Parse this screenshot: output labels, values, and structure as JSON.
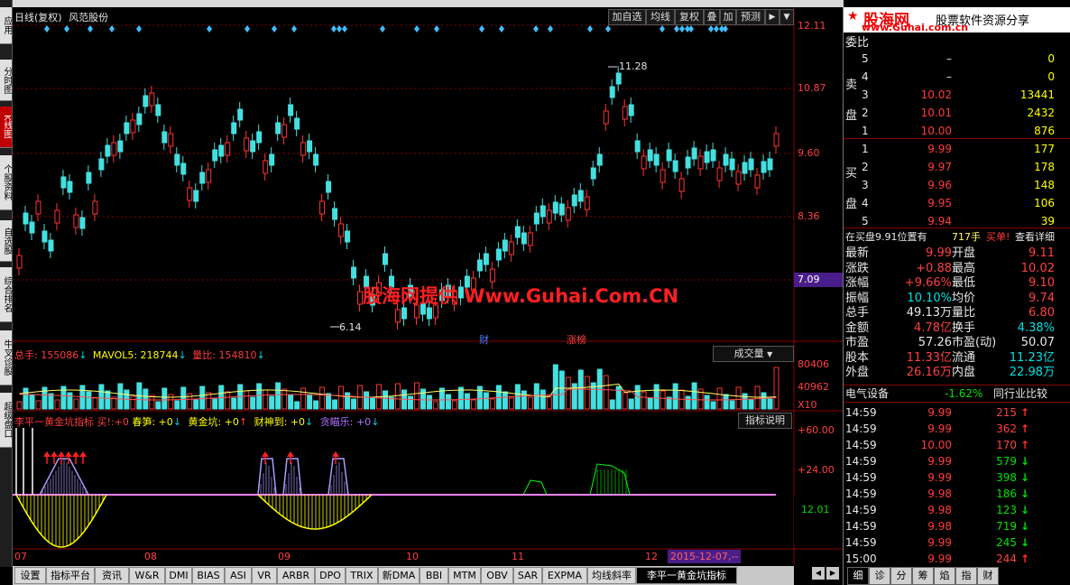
{
  "left_toolbar": [
    {
      "label": "应用",
      "active": false
    },
    {
      "label": "分时图",
      "active": false
    },
    {
      "label": "K线图",
      "active": true
    },
    {
      "label": "个股资料",
      "active": false
    },
    {
      "label": "自选股",
      "active": false
    },
    {
      "label": "综合排名",
      "active": false
    },
    {
      "label": "牛叉诊股",
      "active": false
    },
    {
      "label": "超级盘口",
      "active": false
    }
  ],
  "chart_header": {
    "title": "日线(复权)",
    "pattern": "风范股份"
  },
  "toolbar_buttons": [
    "加自选",
    "均线",
    "复权",
    "叠",
    "加",
    "预测"
  ],
  "watermark": "股海网提供 Www.Guhai.Com.CN",
  "price_axis": [
    "12.11",
    "10.87",
    "9.60",
    "8.36",
    "7.09"
  ],
  "high_label": "11.28",
  "low_label": "6.14",
  "event_labels": [
    "财",
    "涨榜"
  ],
  "volume_header": {
    "total_label": "总手: 155086",
    "mavol_label": "MAVOL5: 218744",
    "ratio_label": "量比: 154810",
    "dropdown": "成交量"
  },
  "volume_axis": [
    "80406",
    "40962",
    "X10"
  ],
  "indicator_header": {
    "name": "李平一黄金坑指标",
    "buy": "买!",
    "buy_val": ":+0",
    "chunsun": "春笋: +0",
    "huangjin": "黄金坑: +0",
    "caishen": "财神到: +0",
    "tanmi": "贪瞄乐: +0",
    "help_btn": "指标说明"
  },
  "indicator_axis": [
    "+60.00",
    "+24.00",
    "12.01"
  ],
  "date_axis": [
    "07",
    "08",
    "09",
    "10",
    "11",
    "12",
    "2015-12-07,--"
  ],
  "bottom_tabs": [
    "设置",
    "指标平台",
    "资讯",
    "W&R",
    "DMI",
    "BIAS",
    "ASI",
    "VR",
    "ARBR",
    "DPO",
    "TRIX",
    "新DMA",
    "BBI",
    "MTM",
    "OBV",
    "SAR",
    "EXPMA",
    "均线斜率",
    "李平一黄金坑指标"
  ],
  "brand": {
    "name": "股海网",
    "url": "www.Guhai.com.cn",
    "slogan": "股票软件资源分享"
  },
  "order_book": {
    "header": "委比",
    "sell_label": "卖盘",
    "buy_label": "买盘",
    "sell": [
      {
        "level": "5",
        "price": "–",
        "vol": "0"
      },
      {
        "level": "4",
        "price": "–",
        "vol": "0"
      },
      {
        "level": "3",
        "price": "10.02",
        "vol": "13441"
      },
      {
        "level": "2",
        "price": "10.01",
        "vol": "2432"
      },
      {
        "level": "1",
        "price": "10.00",
        "vol": "876"
      }
    ],
    "buy": [
      {
        "level": "1",
        "price": "9.99",
        "vol": "177"
      },
      {
        "level": "2",
        "price": "9.97",
        "vol": "178"
      },
      {
        "level": "3",
        "price": "9.96",
        "vol": "148"
      },
      {
        "level": "4",
        "price": "9.95",
        "vol": "106"
      },
      {
        "level": "5",
        "price": "9.94",
        "vol": "39"
      }
    ]
  },
  "order_status": {
    "text": "在买盘9.91位置有",
    "vol": "717手",
    "buy": "买单!",
    "detail": "查看详细"
  },
  "quote": [
    {
      "l1": "最新",
      "v1": "9.99",
      "l2": "开盘",
      "v2": "9.11"
    },
    {
      "l1": "涨跌",
      "v1": "+0.88",
      "l2": "最高",
      "v2": "10.02"
    },
    {
      "l1": "涨幅",
      "v1": "+9.66%",
      "l2": "最低",
      "v2": "9.10"
    },
    {
      "l1": "振幅",
      "v1": "10.10%",
      "l2": "均价",
      "v2": "9.74"
    },
    {
      "l1": "总手",
      "v1": "49.13万",
      "l2": "量比",
      "v2": "6.80"
    },
    {
      "l1": "金额",
      "v1": "4.78亿",
      "l2": "换手",
      "v2": "4.38%"
    },
    {
      "l1": "市盈",
      "v1": "57.26",
      "l2": "市盈(动)",
      "v2": "50.07"
    },
    {
      "l1": "股本",
      "v1": "11.33亿",
      "l2": "流通",
      "v2": "11.23亿"
    },
    {
      "l1": "外盘",
      "v1": "26.16万",
      "l2": "内盘",
      "v2": "22.98万"
    }
  ],
  "sector": {
    "name": "电气设备",
    "change": "-1.62%",
    "compare": "同行业比较"
  },
  "ticks": [
    {
      "time": "14:59",
      "price": "9.99",
      "vol": "215",
      "dir": "up"
    },
    {
      "time": "14:59",
      "price": "9.99",
      "vol": "362",
      "dir": "up"
    },
    {
      "time": "14:59",
      "price": "10.00",
      "vol": "170",
      "dir": "up"
    },
    {
      "time": "14:59",
      "price": "9.99",
      "vol": "579",
      "dir": "down"
    },
    {
      "time": "14:59",
      "price": "9.99",
      "vol": "398",
      "dir": "down"
    },
    {
      "time": "14:59",
      "price": "9.98",
      "vol": "186",
      "dir": "down"
    },
    {
      "time": "14:59",
      "price": "9.98",
      "vol": "123",
      "dir": "down"
    },
    {
      "time": "14:59",
      "price": "9.98",
      "vol": "719",
      "dir": "down"
    },
    {
      "time": "14:59",
      "price": "9.99",
      "vol": "245",
      "dir": "down"
    },
    {
      "time": "15:00",
      "price": "9.99",
      "vol": "244",
      "dir": "up"
    }
  ],
  "right_tabs": [
    "细",
    "诊",
    "分",
    "筹",
    "焰",
    "指",
    "财"
  ],
  "colors": {
    "up": "#ff3333",
    "down": "#44e0e0",
    "ma": "#ffff66",
    "grid": "#8a0000"
  }
}
